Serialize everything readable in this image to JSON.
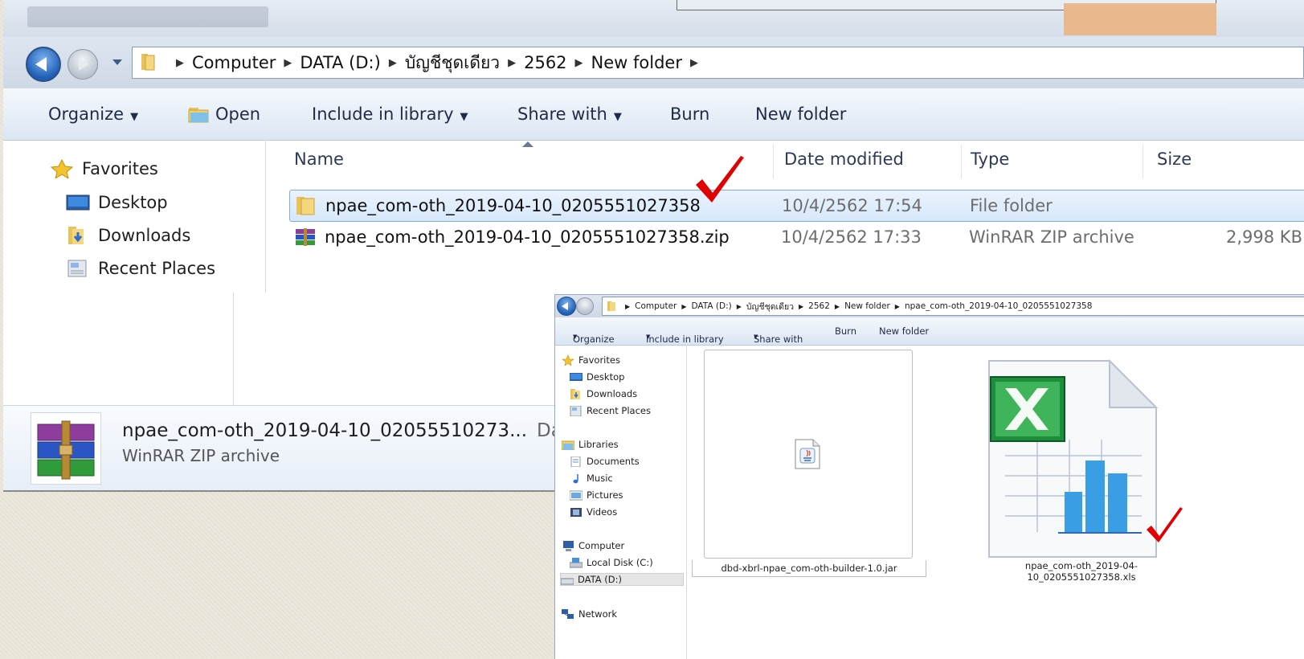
{
  "main_window": {
    "address": {
      "crumbs": [
        "Computer",
        "DATA (D:)",
        "บัญชีชุดเดียว",
        "2562",
        "New folder"
      ]
    },
    "toolbar": {
      "organize": "Organize",
      "open": "Open",
      "include_in_library": "Include in library",
      "share_with": "Share with",
      "burn": "Burn",
      "new_folder": "New folder"
    },
    "nav": {
      "favorites": "Favorites",
      "desktop": "Desktop",
      "downloads": "Downloads",
      "recent_places": "Recent Places"
    },
    "columns": {
      "name": "Name",
      "date_modified": "Date modified",
      "type": "Type",
      "size": "Size"
    },
    "files": [
      {
        "name": "npae_com-oth_2019-04-10_0205551027358",
        "date": "10/4/2562 17:54",
        "type": "File folder",
        "size": ""
      },
      {
        "name": "npae_com-oth_2019-04-10_0205551027358.zip",
        "date": "10/4/2562 17:33",
        "type": "WinRAR ZIP archive",
        "size": "2,998 KB"
      }
    ],
    "details": {
      "name": "npae_com-oth_2019-04-10_02055510273...",
      "date_label": "Date mod",
      "type": "WinRAR ZIP archive"
    }
  },
  "sub_window": {
    "address": {
      "crumbs": [
        "Computer",
        "DATA (D:)",
        "บัญชีชุดเดียว",
        "2562",
        "New folder",
        "npae_com-oth_2019-04-10_0205551027358"
      ]
    },
    "toolbar": {
      "organize": "Organize",
      "include_in_library": "Include in library",
      "share_with": "Share with",
      "burn": "Burn",
      "new_folder": "New folder"
    },
    "nav": {
      "favorites": "Favorites",
      "desktop": "Desktop",
      "downloads": "Downloads",
      "recent_places": "Recent Places",
      "libraries": "Libraries",
      "documents": "Documents",
      "music": "Music",
      "pictures": "Pictures",
      "videos": "Videos",
      "computer": "Computer",
      "local_disk": "Local Disk (C:)",
      "data_drive": "DATA (D:)",
      "network": "Network"
    },
    "items": [
      {
        "name": "dbd-xbrl-npae_com-oth-builder-1.0.jar"
      },
      {
        "name": "npae_com-oth_2019-04-10_0205551027358.xls"
      }
    ]
  },
  "colors": {
    "selection": "#d7e8fb",
    "check": "#e00000",
    "excel_green": "#1e8e3e"
  }
}
